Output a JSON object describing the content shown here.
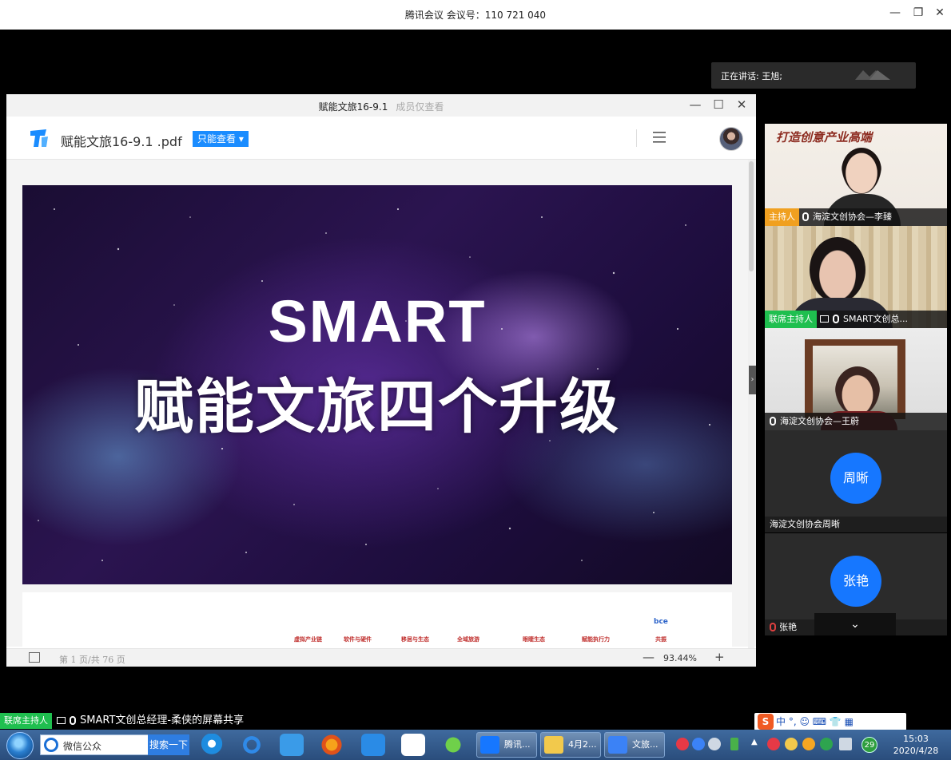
{
  "meeting": {
    "title": "腾讯会议 会议号：110 721 040",
    "speaking": "正在讲话: 王旭;"
  },
  "pdf_window": {
    "title": "赋能文旅16-9.1",
    "title_note": "成员仅查看",
    "file_name": "赋能文旅16-9.1 .pdf",
    "view_badge": "只能查看",
    "slide_line1": "SMART",
    "slide_line2": "赋能文旅四个升级",
    "page2_categories": [
      "虚拟产业链",
      "软件与硬件",
      "移居与生态",
      "全域旅游",
      "眼睫生态",
      "赋能执行力",
      "共振"
    ],
    "page2_brand": "bce",
    "page_indicator": "第 1 页/共 76 页",
    "zoom": "93.44%",
    "zoom_minus": "—",
    "zoom_plus": "+"
  },
  "participants": {
    "t1": {
      "role": "主持人",
      "name": "海淀文创协会—李臻",
      "banner": "打造创意产业高端"
    },
    "t2": {
      "role": "联席主持人",
      "name": "SMART文创总..."
    },
    "t3": {
      "name": "海淀文创协会—王蔚"
    },
    "t4": {
      "avatar": "周晰",
      "name": "海淀文创协会周晰"
    },
    "t5": {
      "avatar": "张艳",
      "name": "张艳"
    }
  },
  "share": {
    "role": "联席主持人",
    "text": "SMART文创总经理-柔侠的屏幕共享"
  },
  "ime": {
    "logo": "S",
    "text": "中 °, ☺ ⌨ 👕 ▦"
  },
  "taskbar": {
    "search_text": "微信公众",
    "search_button": "搜索一下",
    "windows": [
      {
        "label": "腾讯..."
      },
      {
        "label": "4月2..."
      },
      {
        "label": "文旅..."
      }
    ],
    "badge": "29",
    "time": "15:03",
    "date": "2020/4/28"
  },
  "colors": {
    "host_tag": "#f0a020",
    "cohost_tag": "#1fbf4f",
    "avatar_blue": "#1677ff",
    "view_badge": "#1a8cff"
  }
}
